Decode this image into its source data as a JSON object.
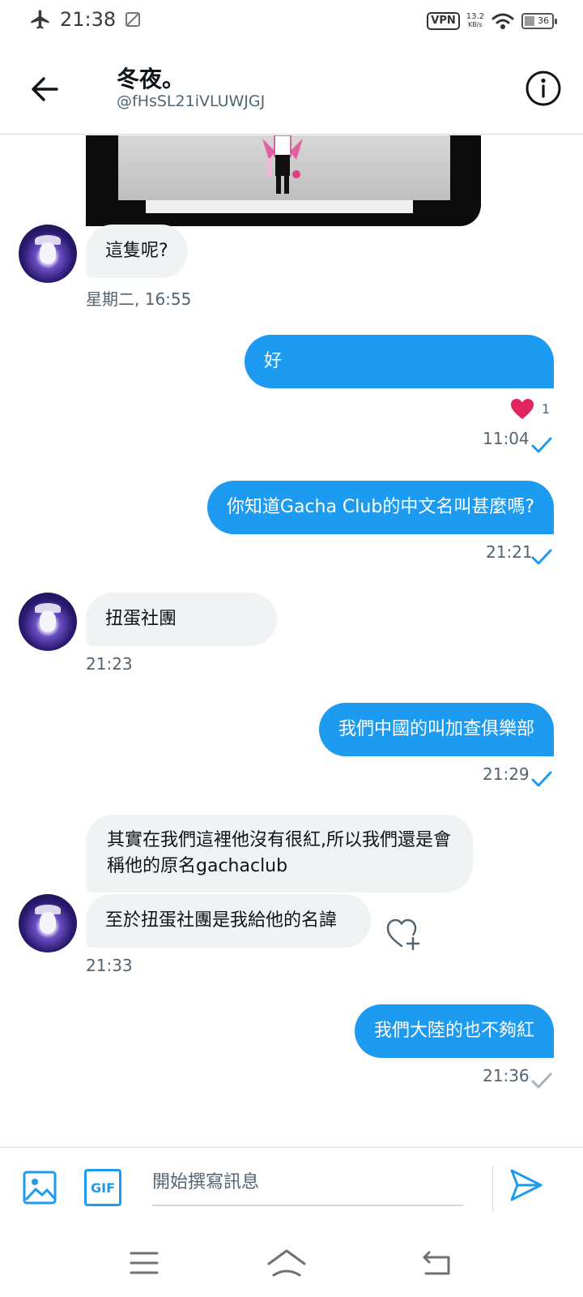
{
  "status_bar": {
    "time": "21:38",
    "vpn": "VPN",
    "speed_value": "13.2",
    "speed_unit": "KB/s",
    "battery": "36",
    "battery_level": 0.36
  },
  "header": {
    "name": "冬夜。",
    "handle": "@fHsSL21iVLUWJGJ"
  },
  "colors": {
    "accent": "#1d9bf0",
    "incoming_bubble": "#eff3f4",
    "heart": "#e0245e",
    "muted_text": "#536471"
  },
  "messages": {
    "m1": {
      "text": "這隻呢?",
      "time": "星期二, 16:55"
    },
    "m2": {
      "text": "好",
      "like_count": "1",
      "time": "11:04",
      "status": "read"
    },
    "m3": {
      "text": "你知道Gacha Club的中文名叫甚麼嗎?",
      "time": "21:21",
      "status": "read"
    },
    "m4": {
      "text": "扭蛋社團",
      "time": "21:23"
    },
    "m5": {
      "text": "我們中國的叫加查俱樂部",
      "time": "21:29",
      "status": "read"
    },
    "m6": {
      "text": "其實在我們這裡他沒有很紅,所以我們還是會稱他的原名gachaclub"
    },
    "m7": {
      "text": "至於扭蛋社團是我給他的名諱",
      "time": "21:33"
    },
    "m8": {
      "text": "我們大陸的也不夠紅",
      "time": "21:36",
      "status": "sent"
    }
  },
  "composer": {
    "placeholder": "開始撰寫訊息",
    "gif_label": "GIF"
  }
}
